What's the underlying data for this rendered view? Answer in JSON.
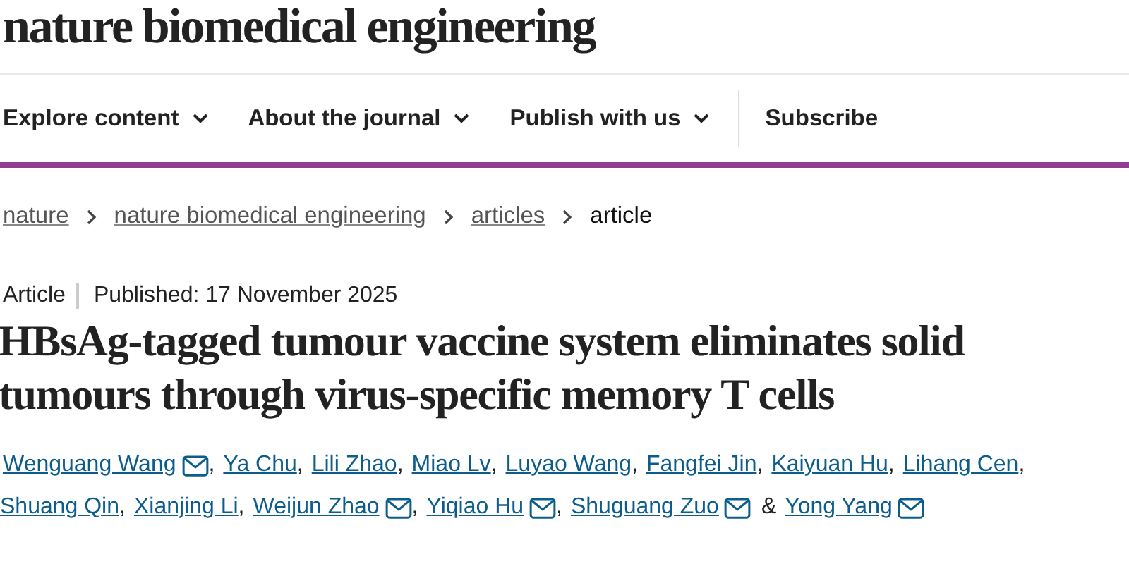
{
  "logo": "nature biomedical engineering",
  "nav": [
    {
      "label": "Explore content",
      "dropdown": true
    },
    {
      "label": "About the journal",
      "dropdown": true
    },
    {
      "label": "Publish with us",
      "dropdown": true
    },
    {
      "label": "Subscribe",
      "dropdown": false
    }
  ],
  "breadcrumbs": [
    {
      "label": "nature",
      "current": false
    },
    {
      "label": "nature biomedical engineering",
      "current": false
    },
    {
      "label": "articles",
      "current": false
    },
    {
      "label": "article",
      "current": true
    }
  ],
  "article_type": "Article",
  "published": "Published: 17 November 2025",
  "title_lines": [
    "HBsAg-tagged tumour vaccine system eliminates solid",
    "tumours through virus-specific memory T cells"
  ],
  "authors": [
    {
      "name": "Wenguang Wang",
      "email": true,
      "separator": ","
    },
    {
      "name": "Ya Chu",
      "email": false,
      "separator": ","
    },
    {
      "name": "Lili Zhao",
      "email": false,
      "separator": ","
    },
    {
      "name": "Miao Lv",
      "email": false,
      "separator": ","
    },
    {
      "name": "Luyao Wang",
      "email": false,
      "separator": ","
    },
    {
      "name": "Fangfei Jin",
      "email": false,
      "separator": ","
    },
    {
      "name": "Kaiyuan Hu",
      "email": false,
      "separator": ","
    },
    {
      "name": "Lihang Cen",
      "email": false,
      "separator": ","
    },
    {
      "name": "Shuang Qin",
      "email": false,
      "separator": ","
    },
    {
      "name": "Xianjing Li",
      "email": false,
      "separator": ","
    },
    {
      "name": "Weijun Zhao",
      "email": true,
      "separator": ","
    },
    {
      "name": "Yiqiao Hu",
      "email": true,
      "separator": ","
    },
    {
      "name": "Shuguang Zuo",
      "email": true,
      "separator": "&"
    },
    {
      "name": "Yong Yang",
      "email": true
    }
  ]
}
